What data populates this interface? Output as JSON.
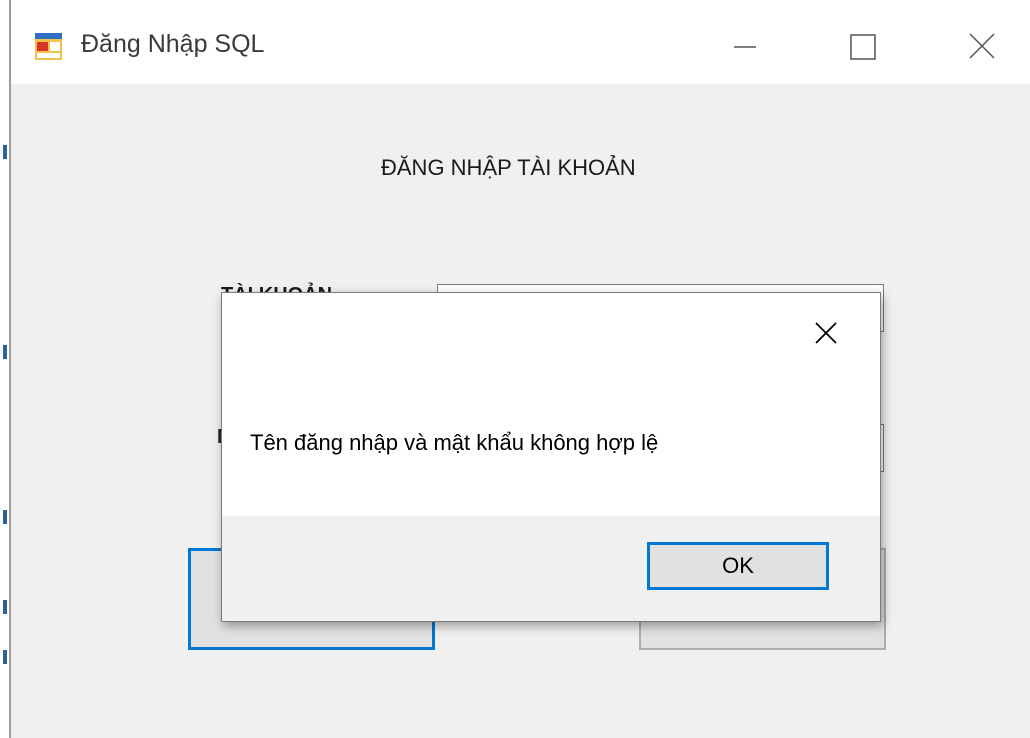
{
  "window": {
    "title": "Đăng Nhập SQL",
    "icon": "windows-form-icon"
  },
  "caption_buttons": {
    "minimize": "minimize-icon",
    "maximize": "maximize-icon",
    "close": "close-icon"
  },
  "form": {
    "heading": "ĐĂNG NHẬP TÀI KHOẢN",
    "username_label": "TÀI KHOẢN",
    "password_label": "M"
  },
  "dialog": {
    "message": "Tên đăng nhập và mật khẩu không hợp lệ",
    "ok_label": "OK",
    "close_icon": "close-icon"
  },
  "colors": {
    "accent": "#0078d7",
    "window_bg": "#f0f0f0",
    "titlebar_bg": "#ffffff"
  }
}
